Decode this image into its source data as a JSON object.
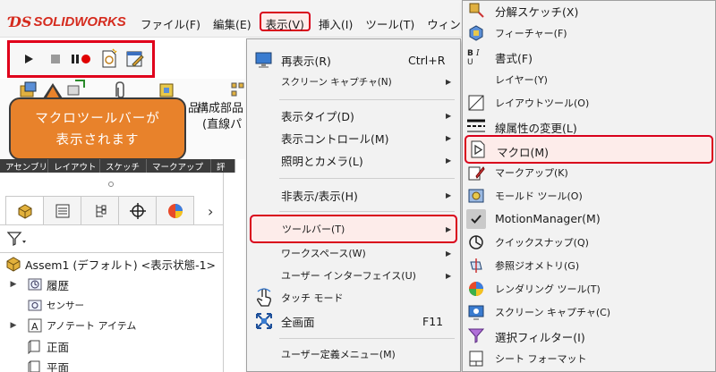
{
  "app": {
    "logo_text": "SOLIDWORKS",
    "brand_color": "#d52b1e",
    "highlight_color": "#e0001b"
  },
  "menubar": {
    "items": [
      "ファイル(F)",
      "編集(E)",
      "表示(V)",
      "挿入(I)",
      "ツール(T)",
      "ウィンドウ(W)"
    ]
  },
  "macro_toolbar": {
    "buttons": [
      "play-icon",
      "stop-icon",
      "pause-record-icon",
      "new-macro-icon",
      "edit-macro-icon"
    ]
  },
  "ribbon": {
    "label_line1": "構成部品",
    "label_line2": "(直線パ",
    "label_left": "品"
  },
  "callout": {
    "line1": "マクロツールバーが",
    "line2": "表示されます",
    "color": "#e8822b"
  },
  "command_tabs": [
    "アセンブリ",
    "レイアウト",
    "スケッチ",
    "マークアップ",
    "評"
  ],
  "feature_tree": {
    "root": "Assem1 (デフォルト) <表示状態-1>",
    "items": [
      {
        "label": "履歴",
        "expandable": true
      },
      {
        "label": "センサー",
        "expandable": false
      },
      {
        "label": "アノテート アイテム",
        "expandable": true
      },
      {
        "label": "正面",
        "expandable": false
      },
      {
        "label": "平面",
        "expandable": false
      }
    ]
  },
  "view_menu": {
    "items": [
      {
        "label": "再表示(R)",
        "shortcut": "Ctrl+R",
        "icon": "redraw-icon"
      },
      {
        "label": "スクリーン キャプチャ(N)",
        "submenu": true
      },
      {
        "label": "表示タイプ(D)",
        "submenu": true
      },
      {
        "label": "表示コントロール(M)",
        "submenu": true
      },
      {
        "label": "照明とカメラ(L)",
        "submenu": true
      },
      {
        "label": "非表示/表示(H)",
        "submenu": true
      },
      {
        "label": "ツールバー(T)",
        "submenu": true,
        "highlighted": true
      },
      {
        "label": "ワークスペース(W)",
        "submenu": true
      },
      {
        "label": "ユーザー インターフェイス(U)",
        "submenu": true
      },
      {
        "label": "タッチ モード",
        "icon": "touch-mode-icon"
      },
      {
        "label": "全画面",
        "shortcut": "F11",
        "icon": "fullscreen-icon"
      },
      {
        "label": "ユーザー定義メニュー(M)"
      }
    ]
  },
  "toolbar_submenu": {
    "items": [
      {
        "label": "分解スケッチ(X)",
        "icon": "explode-sketch-icon"
      },
      {
        "label": "フィーチャー(F)",
        "icon": "features-icon"
      },
      {
        "label": "書式(F)",
        "icon": "format-icon"
      },
      {
        "label": "レイヤー(Y)",
        "icon": ""
      },
      {
        "label": "レイアウトツール(O)",
        "icon": "layout-tools-icon"
      },
      {
        "label": "線属性の変更(L)",
        "icon": "line-format-icon"
      },
      {
        "label": "マクロ(M)",
        "icon": "macro-icon",
        "highlighted": true
      },
      {
        "label": "マークアップ(K)",
        "icon": "markup-icon"
      },
      {
        "label": "モールド ツール(O)",
        "icon": "mold-tools-icon"
      },
      {
        "label": "MotionManager(M)",
        "icon": "check-icon",
        "checked": true
      },
      {
        "label": "クイックスナップ(Q)",
        "icon": "quick-snaps-icon"
      },
      {
        "label": "参照ジオメトリ(G)",
        "icon": "reference-geometry-icon"
      },
      {
        "label": "レンダリング ツール(T)",
        "icon": "render-tools-icon"
      },
      {
        "label": "スクリーン キャプチャ(C)",
        "icon": "screen-capture-icon"
      },
      {
        "label": "選択フィルター(I)",
        "icon": "selection-filter-icon"
      },
      {
        "label": "シート フォーマット",
        "icon": "sheet-format-icon"
      }
    ]
  }
}
